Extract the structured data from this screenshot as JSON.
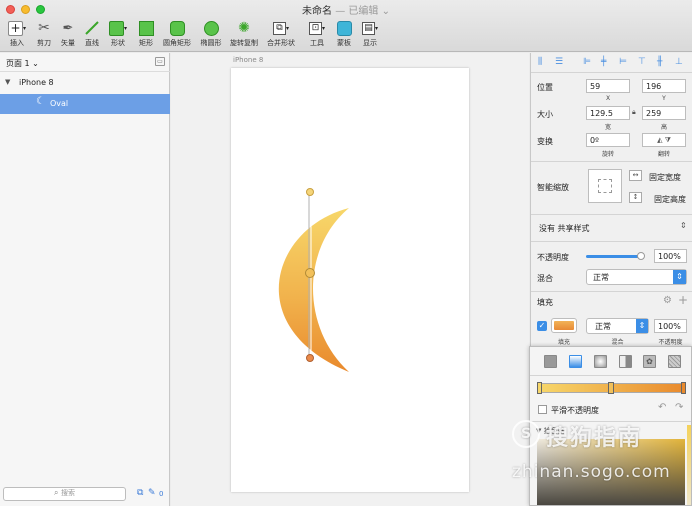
{
  "window": {
    "title": "未命名",
    "subtitle": "— 已编辑 ⌄"
  },
  "toolbar": {
    "insert": "插入",
    "scissors": "剪刀",
    "vector": "矢量",
    "line": "直线",
    "shape": "形状",
    "rect": "矩形",
    "rounded_rect": "圆角矩形",
    "oval": "椭圆形",
    "rotate_copy": "旋转复制",
    "combine": "合并形状",
    "tools": "工具",
    "mask": "蒙板",
    "display": "显示"
  },
  "layers": {
    "page_selector": "页面 1 ⌄",
    "artboard": "iPhone 8",
    "layer": "Oval",
    "search_placeholder": "搜索",
    "count": "0"
  },
  "canvas": {
    "artboard_label": "iPhone 8",
    "shape_gradient": {
      "from": "#f5cf6a",
      "to": "#e99a3d"
    }
  },
  "inspector": {
    "position_label": "位置",
    "x_value": "59",
    "y_value": "196",
    "x_label": "X",
    "y_label": "Y",
    "size_label": "大小",
    "width_value": "129.5",
    "height_value": "259",
    "width_label": "宽",
    "height_label": "高",
    "transform_label": "变换",
    "rotation_value": "0º",
    "rotation_label": "旋转",
    "flip_label": "翻转",
    "smart_resize_label": "智能缩放",
    "fixed_width": "固定宽度",
    "fixed_height": "固定高度",
    "shared_style": "没有 共享样式",
    "opacity_label": "不透明度",
    "opacity_value": "100%",
    "blend_label": "混合",
    "blend_value": "正常",
    "fill_title": "填充",
    "fill_blend": "正常",
    "fill_opacity": "100%",
    "fill_color_label": "填充",
    "fill_blend_label": "混合",
    "fill_opacity_label": "不透明度"
  },
  "color_popup": {
    "smooth_opacity": "平滑不透明度",
    "picker_label": "拾色器"
  },
  "watermark": {
    "brand": "搜狗指南",
    "url": "zhinan.sogo.com"
  },
  "colors": {
    "accent": "#3b8ee6",
    "selection": "#6c9fe6",
    "gradient_start": "#f7d76a",
    "gradient_end": "#e98a2d"
  }
}
